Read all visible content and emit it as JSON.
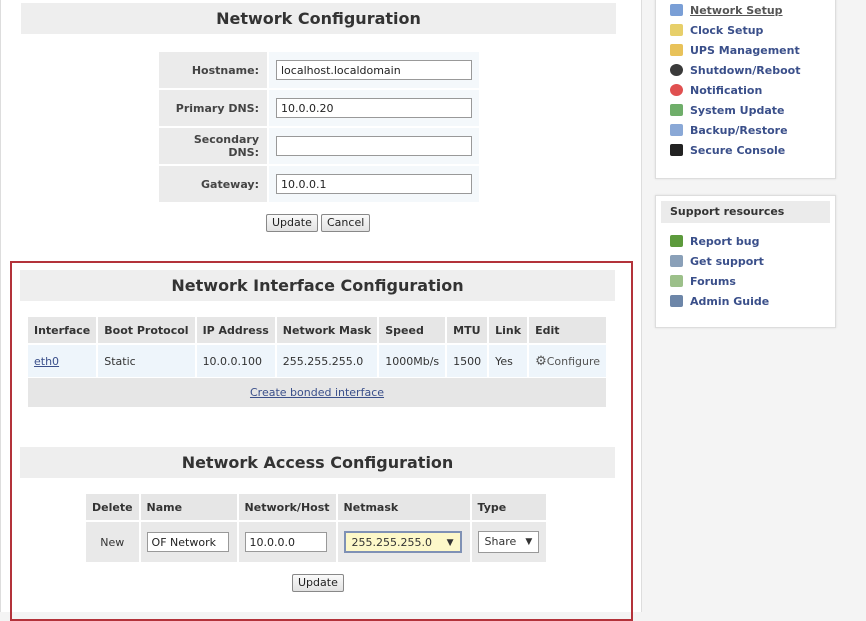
{
  "network_config": {
    "title": "Network Configuration",
    "fields": [
      {
        "label": "Hostname:",
        "value": "localhost.localdomain"
      },
      {
        "label": "Primary DNS:",
        "value": "10.0.0.20"
      },
      {
        "label": "Secondary DNS:",
        "value": ""
      },
      {
        "label": "Gateway:",
        "value": "10.0.0.1"
      }
    ],
    "update_label": "Update",
    "cancel_label": "Cancel"
  },
  "interface_config": {
    "title": "Network Interface Configuration",
    "columns": [
      "Interface",
      "Boot Protocol",
      "IP Address",
      "Network Mask",
      "Speed",
      "MTU",
      "Link",
      "Edit"
    ],
    "rows": [
      {
        "interface": "eth0",
        "boot_protocol": "Static",
        "ip": "10.0.0.100",
        "mask": "255.255.255.0",
        "speed": "1000Mb/s",
        "mtu": "1500",
        "link": "Yes",
        "edit": "Configure"
      }
    ],
    "bond_link": "Create bonded interface"
  },
  "access_config": {
    "title": "Network Access Configuration",
    "columns": [
      "Delete",
      "Name",
      "Network/Host",
      "Netmask",
      "Type"
    ],
    "new_row": {
      "delete": "New",
      "name": "OF Network",
      "network": "10.0.0.0",
      "netmask": "255.255.255.0",
      "type": "Share"
    },
    "update_label": "Update"
  },
  "sidebar": {
    "menu": [
      {
        "label": "Network Setup",
        "icon": "network-icon",
        "active": true
      },
      {
        "label": "Clock Setup",
        "icon": "clock-icon"
      },
      {
        "label": "UPS Management",
        "icon": "ups-icon"
      },
      {
        "label": "Shutdown/Reboot",
        "icon": "power-icon"
      },
      {
        "label": "Notification",
        "icon": "alert-icon"
      },
      {
        "label": "System Update",
        "icon": "update-icon"
      },
      {
        "label": "Backup/Restore",
        "icon": "backup-icon"
      },
      {
        "label": "Secure Console",
        "icon": "console-icon"
      }
    ],
    "support_title": "Support resources",
    "support": [
      {
        "label": "Report bug",
        "icon": "bug-icon"
      },
      {
        "label": "Get support",
        "icon": "support-icon"
      },
      {
        "label": "Forums",
        "icon": "forums-icon"
      },
      {
        "label": "Admin Guide",
        "icon": "book-icon"
      }
    ]
  },
  "colors": {
    "accent_frame": "#b3323a",
    "link": "#3a4f8a"
  }
}
